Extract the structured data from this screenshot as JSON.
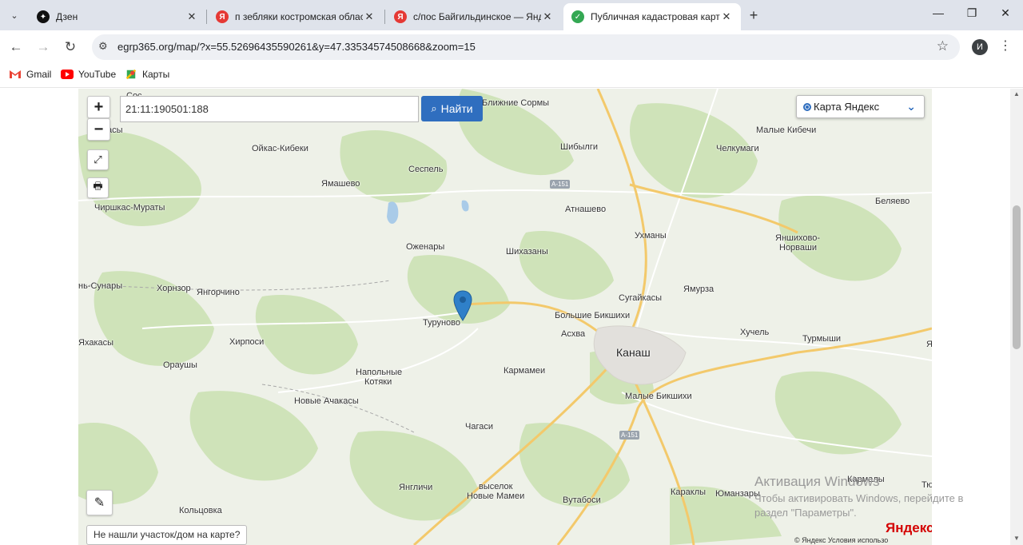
{
  "browser": {
    "tabs": [
      {
        "title": "Дзен",
        "favicon": "dzen-icon",
        "active": false
      },
      {
        "title": "п зебляки костромская облас",
        "favicon": "yandex-icon",
        "active": false
      },
      {
        "title": "с/пос Байгильдинское — Янде",
        "favicon": "yandex-icon",
        "active": false
      },
      {
        "title": "Публичная кадастровая карта",
        "favicon": "check-icon",
        "active": true
      }
    ],
    "url": "egrp365.org/map/?x=55.52696435590261&y=47.33534574508668&zoom=15",
    "profile_initial": "И",
    "bookmarks": [
      {
        "label": "Gmail",
        "icon": "gmail-icon"
      },
      {
        "label": "YouTube",
        "icon": "youtube-icon"
      },
      {
        "label": "Карты",
        "icon": "maps-icon"
      }
    ]
  },
  "map": {
    "zoom_in": "+",
    "zoom_out": "−",
    "search_value": "21:11:190501:188",
    "find_button": "Найти",
    "layer": "Карта Яндекс",
    "not_found_link": "Не нашли участок/дом на карте?",
    "places": [
      "Ближние Сормы",
      "Малые Кибечи",
      "Шибылги",
      "Челкумаги",
      "Ойкас-Кибеки",
      "Сеспель",
      "Ямашево",
      "Чиршкас-Мураты",
      "Атнашево",
      "Беляево",
      "Ухманы",
      "Яншихово-",
      "Норваши",
      "Оженары",
      "Шихазаны",
      "нь-Сунары",
      "Хорнзор",
      "Янгорчино",
      "Сугайкасы",
      "Ямурза",
      "Турунoво",
      "Большие Бикшихи",
      "Асхва",
      "Хучель",
      "Турмыши",
      "Канаш",
      "Яхакасы",
      "Хирпоси",
      "Ораушы",
      "Напольные",
      "Котяки",
      "Кармамеи",
      "Малые Бикшихи",
      "Новые Ачакасы",
      "Чагаси",
      "Янгличи",
      "выселок",
      "Новые Мамеи",
      "Вутабоси",
      "Караклы",
      "Юманзары",
      "Кармалы",
      "Кольцовка",
      "Тю",
      "Я",
      "Сос",
      "асы"
    ],
    "roads": [
      "А-151",
      "А-151"
    ],
    "attribution": "© Яндекс  Условия использо",
    "yandex_logo": "Яндекс"
  },
  "watermark": {
    "title": "Активация Windows",
    "line1": "Чтобы активировать Windows, перейдите в",
    "line2": "раздел \"Параметры\"."
  },
  "colors": {
    "tabstrip": "#dfe3eb",
    "accent_button": "#2f6ebf",
    "marker": "#2f80c9",
    "forest": "#c8dfb0",
    "water": "#a9cbe8",
    "highway": "#f3c96b"
  }
}
